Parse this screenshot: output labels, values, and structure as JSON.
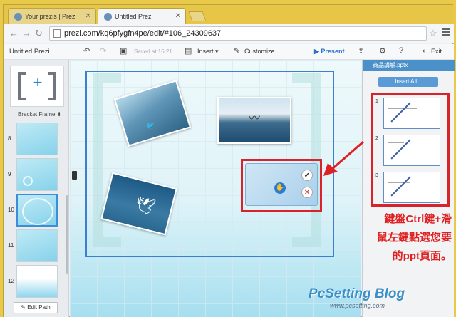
{
  "browser": {
    "tabs": [
      {
        "label": "Your prezis | Prezi",
        "active": false
      },
      {
        "label": "Untitled Prezi",
        "active": true
      }
    ],
    "url": "prezi.com/kq6pfygfn4pe/edit/#106_24309637"
  },
  "header": {
    "title": "Untitled Prezi",
    "saved": "Saved at 16:21",
    "insert": "Insert",
    "customize": "Customize",
    "present": "Present",
    "exit": "Exit"
  },
  "left": {
    "frame_label": "Bracket Frame",
    "thumbs": [
      "8",
      "9",
      "10",
      "11",
      "12"
    ],
    "edit_path": "Edit Path"
  },
  "right": {
    "file": "商品講解.pptx",
    "insert_all": "Insert All...",
    "slides": [
      "1",
      "2",
      "3"
    ]
  },
  "annotation": {
    "lines": [
      "鍵盤Ctrl鍵+滑",
      "鼠左鍵點選您要",
      "的ppt頁面。"
    ],
    "color": "#e02020"
  },
  "watermark": {
    "brand": "PcSetting Blog",
    "site": "www.pcsetting.com"
  }
}
